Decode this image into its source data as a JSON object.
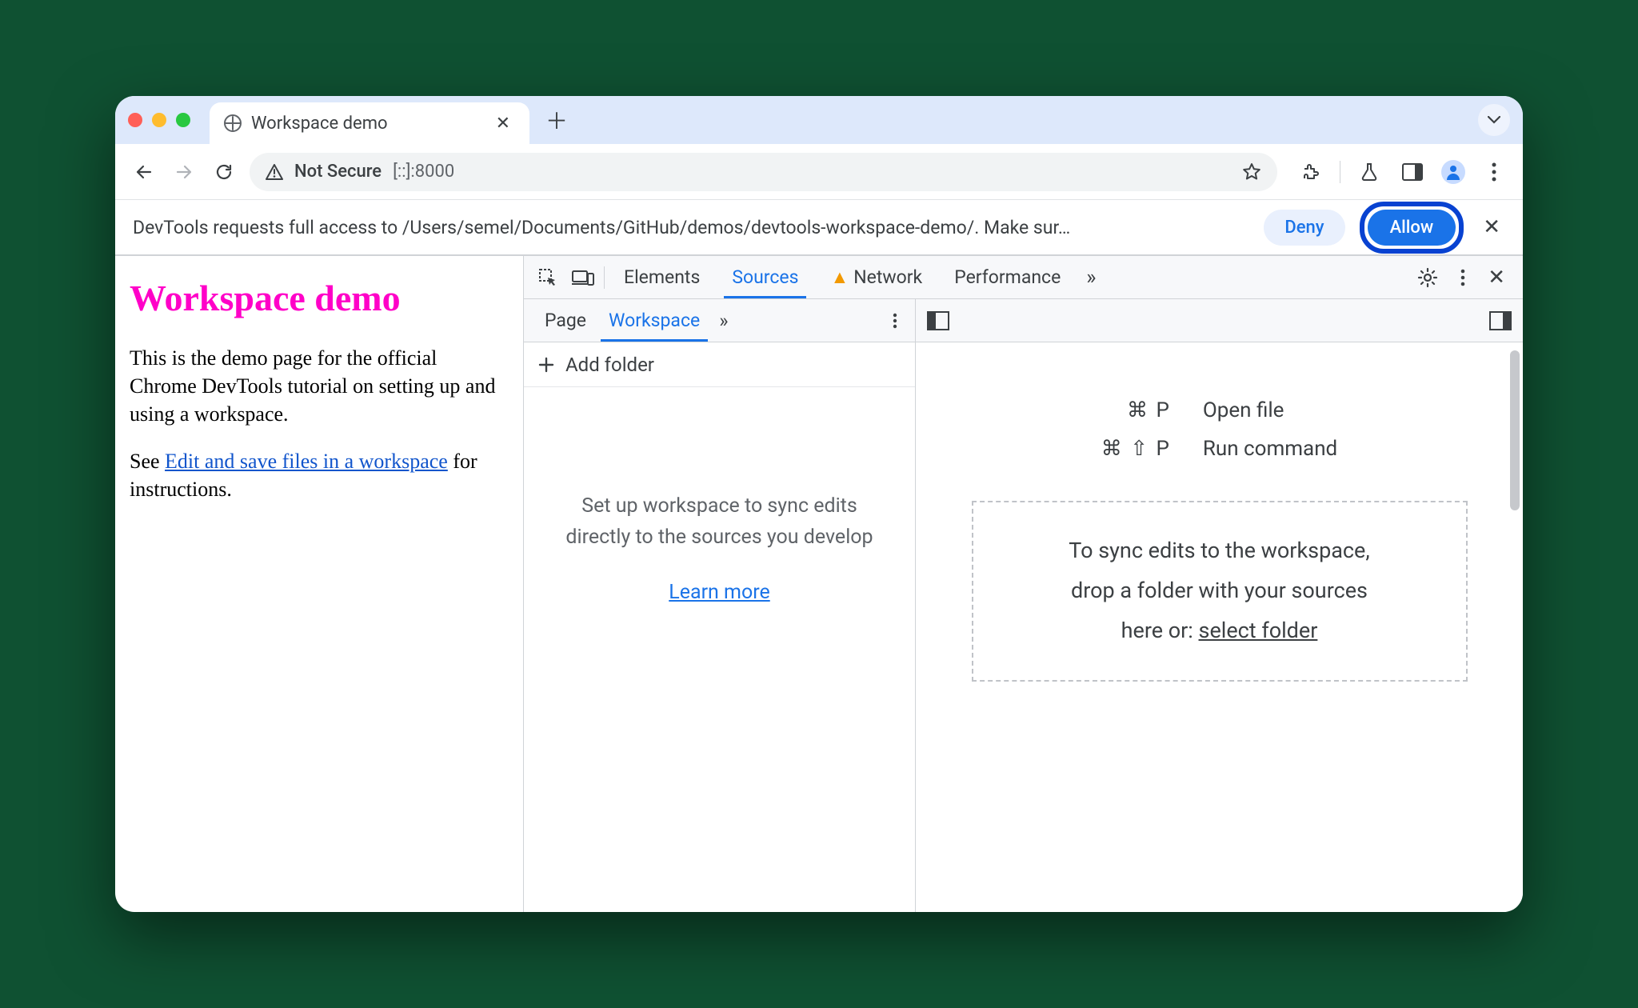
{
  "browser": {
    "tab_title": "Workspace demo",
    "security_label": "Not Secure",
    "url": "[::]:8000"
  },
  "infobar": {
    "message": "DevTools requests full access to /Users/semel/Documents/GitHub/demos/devtools-workspace-demo/. Make sur…",
    "deny": "Deny",
    "allow": "Allow"
  },
  "page": {
    "heading": "Workspace demo",
    "para1": "This is the demo page for the official Chrome DevTools tutorial on setting up and using a workspace.",
    "para2_prefix": "See ",
    "para2_link": "Edit and save files in a workspace",
    "para2_suffix": " for instructions."
  },
  "devtools": {
    "tabs": {
      "elements": "Elements",
      "sources": "Sources",
      "network": "Network",
      "performance": "Performance"
    },
    "sources_subtabs": {
      "page": "Page",
      "workspace": "Workspace"
    },
    "add_folder": "Add folder",
    "workspace_hint": "Set up workspace to sync edits directly to the sources you develop",
    "learn_more": "Learn more",
    "shortcuts": {
      "open_file_keys": "⌘  P",
      "open_file_label": "Open file",
      "run_cmd_keys": "⌘  ⇧  P",
      "run_cmd_label": "Run command"
    },
    "drop_zone_line1": "To sync edits to the workspace,",
    "drop_zone_line2": "drop a folder with your sources",
    "drop_zone_line3_prefix": "here or: ",
    "drop_zone_select": "select folder"
  }
}
